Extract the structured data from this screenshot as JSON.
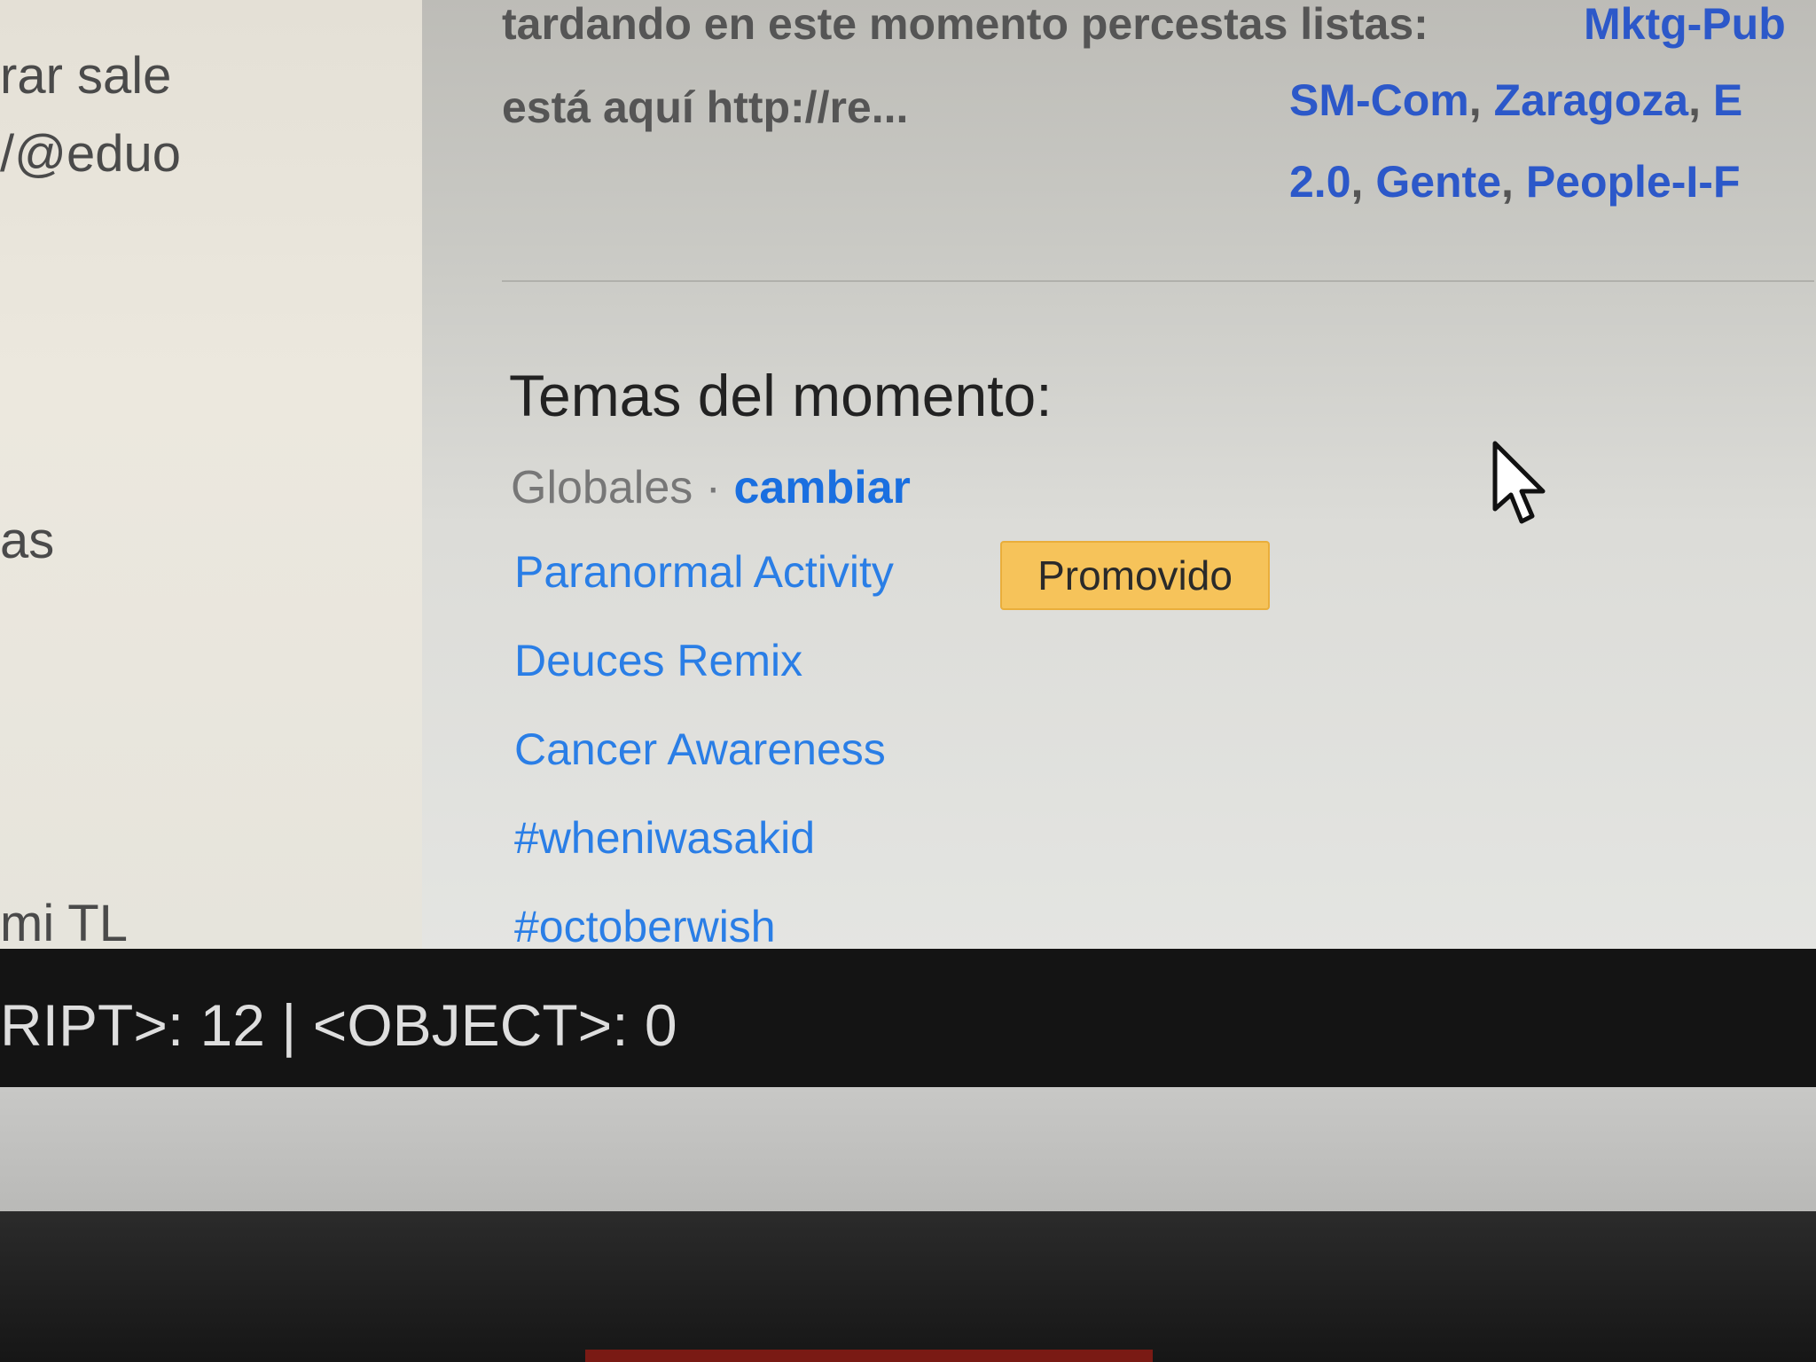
{
  "left_column": {
    "fragments": [
      "rar sale",
      "/@eduo",
      "as",
      "mi TL"
    ]
  },
  "tweet": {
    "line1": "tardando en este momento percestas listas:",
    "line2": "está aquí http://re..."
  },
  "lists": {
    "line1": [
      "Mktg-Pub"
    ],
    "line2": [
      "SM-Com",
      "Zaragoza",
      "E"
    ],
    "line3": [
      "2.0",
      "Gente",
      "People-I-F"
    ],
    "separator": ", "
  },
  "trends": {
    "title": "Temas del momento:",
    "scope_label": "Globales",
    "scope_separator": " · ",
    "change_label": "cambiar",
    "promoted_label": "Promovido",
    "items": [
      "Paranormal Activity",
      "Deuces Remix",
      "Cancer Awareness",
      "#wheniwasakid",
      "#octoberwish"
    ]
  },
  "status_bar": {
    "text": "RIPT>: 12 | <OBJECT>: 0"
  },
  "colors": {
    "link": "#2a7ee6",
    "promoted_bg": "#f6c35a",
    "status_bg": "#141414"
  },
  "icons": {
    "cursor": "arrow-pointer-icon"
  }
}
